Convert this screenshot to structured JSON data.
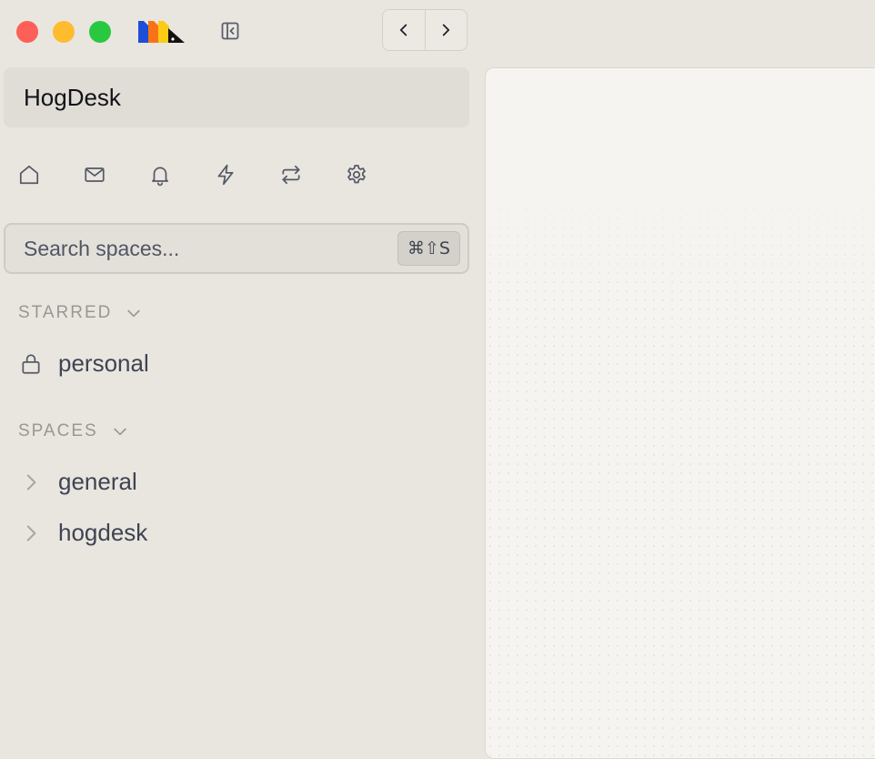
{
  "window": {
    "controls": [
      "close",
      "minimize",
      "maximize"
    ],
    "colors": {
      "close": "#fe5f57",
      "minimize": "#febc2e",
      "maximize": "#28c840"
    },
    "logo_colors": [
      "#1d4ed8",
      "#f97316",
      "#facc15",
      "#111111"
    ]
  },
  "toolbar": {
    "sidebar_toggle_icon": "sidebar-left-icon",
    "back_icon": "chevron-left-icon",
    "forward_icon": "chevron-right-icon"
  },
  "workspace": {
    "name": "HogDesk"
  },
  "quick_nav": [
    {
      "icon": "home-icon"
    },
    {
      "icon": "mail-icon"
    },
    {
      "icon": "bell-icon"
    },
    {
      "icon": "lightning-icon"
    },
    {
      "icon": "repeat-icon"
    },
    {
      "icon": "gear-icon"
    }
  ],
  "search": {
    "placeholder": "Search spaces...",
    "value": "",
    "shortcut": "⌘⇧S"
  },
  "starred": {
    "title": "STARRED",
    "items": [
      {
        "label": "personal",
        "icon": "lock-icon"
      }
    ]
  },
  "spaces": {
    "title": "SPACES",
    "items": [
      {
        "label": "general",
        "icon": "chevron-right-icon"
      },
      {
        "label": "hogdesk",
        "icon": "chevron-right-icon"
      }
    ]
  }
}
